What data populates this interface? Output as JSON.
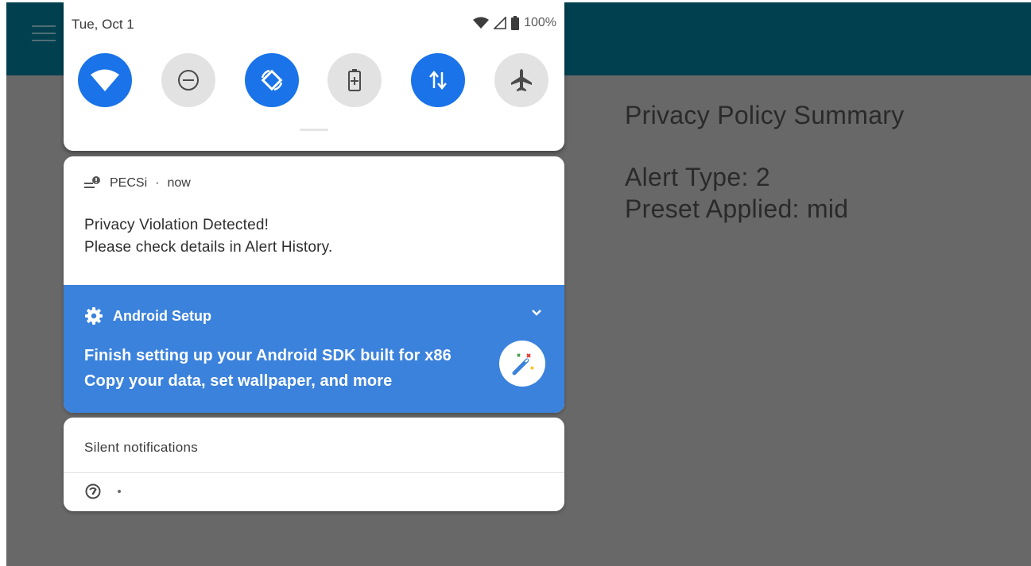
{
  "app": {
    "summary_title": "Privacy Policy Summary",
    "alert_type": "Alert Type: 2",
    "preset_applied": "Preset Applied: mid"
  },
  "quick_settings": {
    "date": "Tue, Oct 1",
    "battery": "100%",
    "tiles": [
      {
        "name": "wifi",
        "state": "on"
      },
      {
        "name": "do-not-disturb",
        "state": "off"
      },
      {
        "name": "auto-rotate",
        "state": "on"
      },
      {
        "name": "battery-saver",
        "state": "off"
      },
      {
        "name": "mobile-data",
        "state": "on"
      },
      {
        "name": "airplane-mode",
        "state": "off"
      }
    ]
  },
  "notifications": {
    "pecsi": {
      "app_name": "PECSi",
      "time": "now",
      "line1": "Privacy Violation Detected!",
      "line2": "Please check details in Alert History."
    },
    "android_setup": {
      "app_name": "Android Setup",
      "line1": "Finish setting up your Android SDK built for x86",
      "line2": "Copy your data, set wallpaper, and more"
    },
    "silent": {
      "header": "Silent notifications"
    }
  },
  "colors": {
    "app_bar": "#00404f",
    "scrim": "#686868",
    "accent": "#1a73e8",
    "setup_card": "#3b82dc"
  }
}
